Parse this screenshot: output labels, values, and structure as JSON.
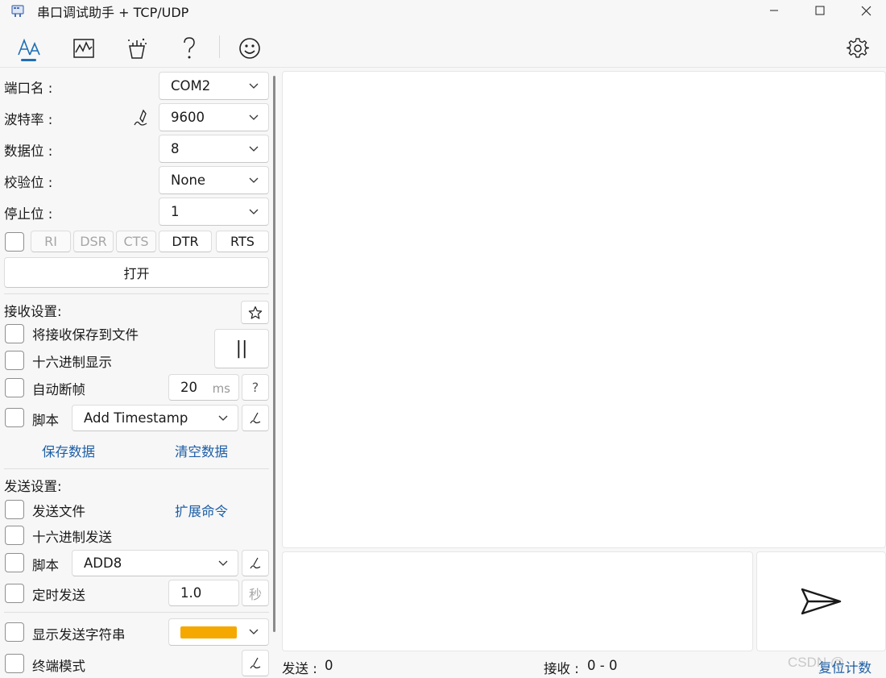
{
  "window": {
    "title": "串口调试助手 + TCP/UDP",
    "minimize_icon": "minimize-icon",
    "maximize_icon": "maximize-icon",
    "close_icon": "close-icon"
  },
  "toolbar": {
    "icons": [
      "text-format-icon",
      "waveform-chart-icon",
      "magic-wand-icon",
      "help-icon",
      "smiley-icon"
    ],
    "settings_icon": "gear-icon",
    "accent": "#1e6fb4"
  },
  "serial": {
    "port_label": "端口名 :",
    "port_value": "COM2",
    "baud_label": "波特率 :",
    "baud_value": "9600",
    "data_bits_label": "数据位 :",
    "data_bits_value": "8",
    "parity_label": "校验位 :",
    "parity_value": "None",
    "stop_bits_label": "停止位 :",
    "stop_bits_value": "1",
    "signals": [
      "RI",
      "DSR",
      "CTS",
      "DTR",
      "RTS"
    ],
    "open_label": "打开"
  },
  "receive": {
    "section_label": "接收设置:",
    "save_to_file": "将接收保存到文件",
    "hex_display": "十六进制显示",
    "auto_frame": "自动断帧",
    "frame_value": "20",
    "frame_unit": "ms",
    "help_label": "?",
    "script_label": "脚本",
    "script_value": "Add Timestamp",
    "pause_label": "||",
    "save_data": "保存数据",
    "clear_data": "清空数据"
  },
  "send": {
    "section_label": "发送设置:",
    "send_file": "发送文件",
    "extend_cmd": "扩展命令",
    "hex_send": "十六进制发送",
    "script_label": "脚本",
    "script_value": "ADD8",
    "timed_send": "定时发送",
    "timer_value": "1.0",
    "timer_unit": "秒",
    "show_send_string": "显示发送字符串",
    "show_send_color": "#f5a800",
    "terminal_mode": "终端模式"
  },
  "status": {
    "sent_label": "发送 :",
    "sent_value": "0",
    "recv_label": "接收 :",
    "recv_value": "0 - 0",
    "reset_count": "复位计数"
  },
  "watermark": "CSDN @..."
}
